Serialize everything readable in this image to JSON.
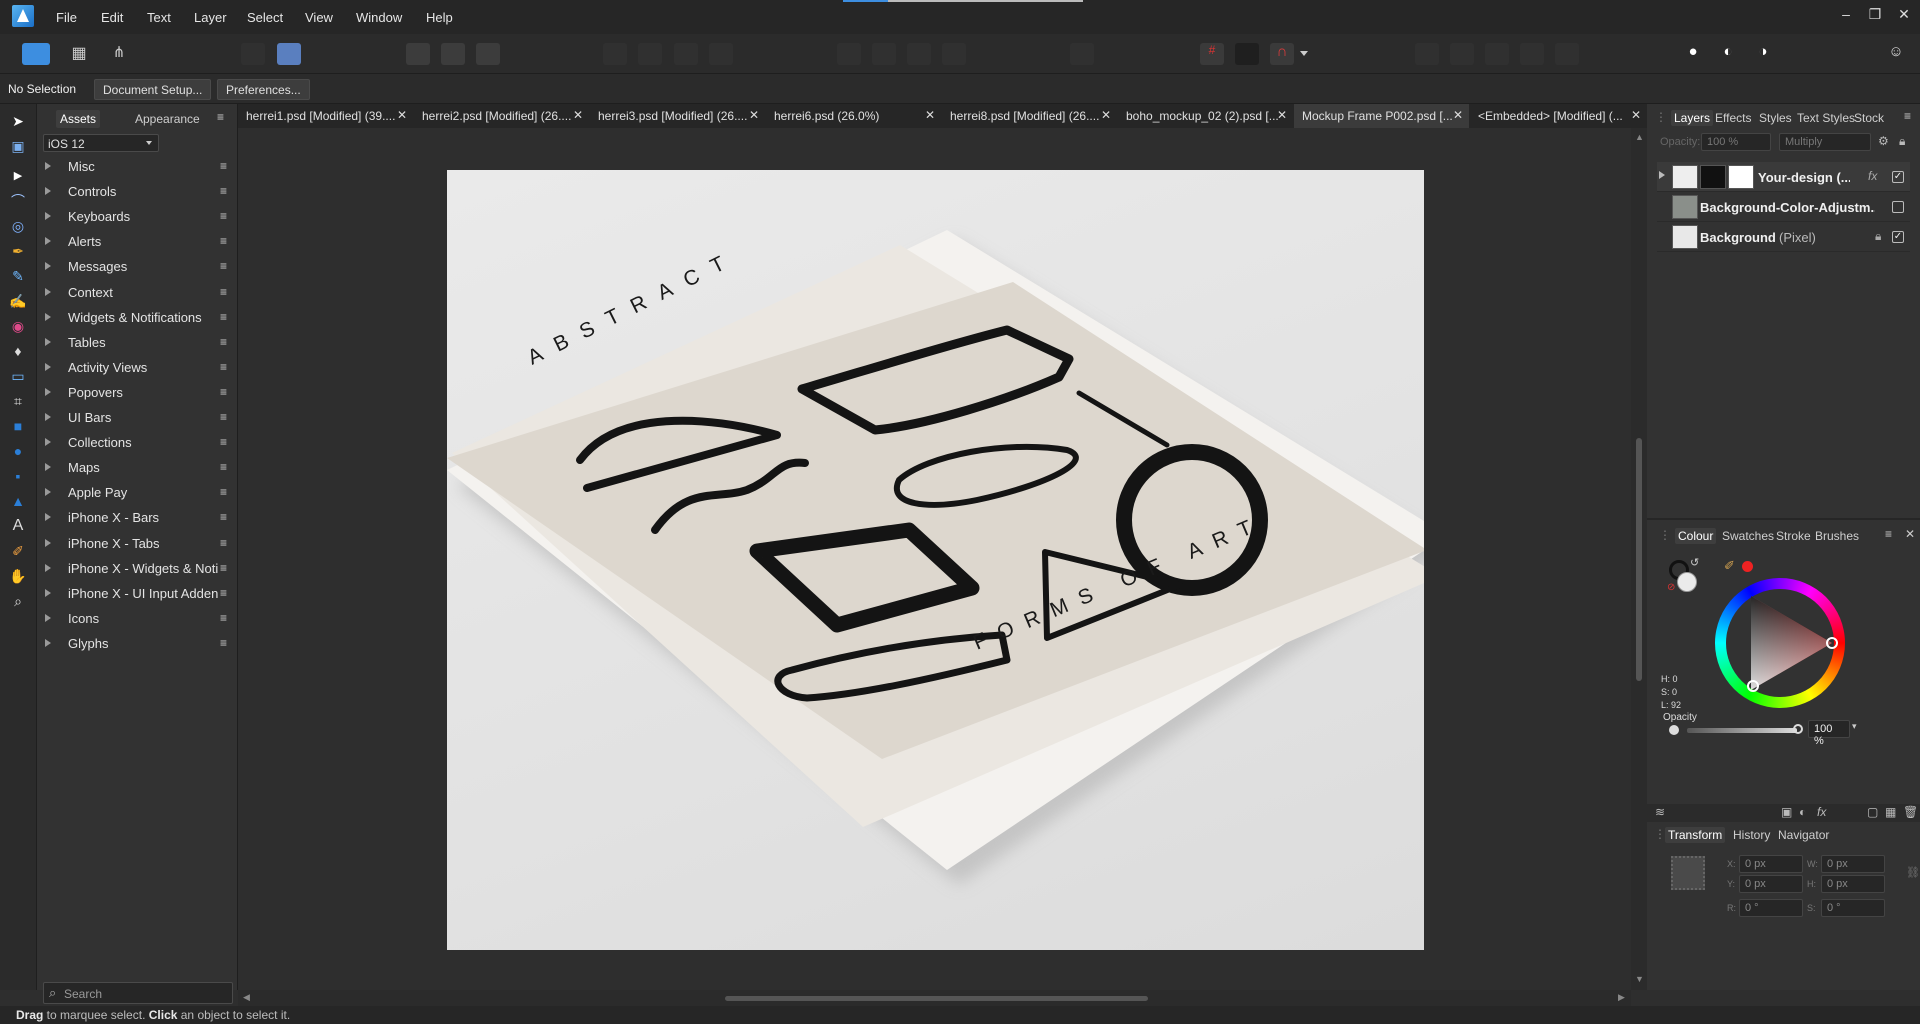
{
  "menu": [
    "File",
    "Edit",
    "Text",
    "Layer",
    "Select",
    "View",
    "Window",
    "Help"
  ],
  "window_controls": {
    "minimize": "–",
    "restore": "❐",
    "close": "✕"
  },
  "context": {
    "selection": "No Selection",
    "document_setup": "Document Setup...",
    "preferences": "Preferences..."
  },
  "left_panel": {
    "tabs": [
      "Assets",
      "Appearance"
    ],
    "dropdown": "iOS 12",
    "items": [
      "Misc",
      "Controls",
      "Keyboards",
      "Alerts",
      "Messages",
      "Context",
      "Widgets & Notifications",
      "Tables",
      "Activity Views",
      "Popovers",
      "UI Bars",
      "Collections",
      "Maps",
      "Apple Pay",
      "iPhone X - Bars",
      "iPhone X - Tabs",
      "iPhone X - Widgets & Noti",
      "iPhone X - UI Input Addend",
      "Icons",
      "Glyphs"
    ],
    "search_placeholder": "Search"
  },
  "doc_tabs": [
    "herrei1.psd [Modified] (39....",
    "herrei2.psd [Modified] (26....",
    "herrei3.psd [Modified] (26....",
    "herrei6.psd (26.0%)",
    "herrei8.psd [Modified] (26....",
    "boho_mockup_02 (2).psd [...",
    "Mockup Frame P002.psd [...",
    "<Embedded> [Modified] (..."
  ],
  "artwork": {
    "top_text": "ABSTRACT",
    "bottom_text": "FORMS OF ART"
  },
  "right_panel": {
    "layer_tabs": [
      "Layers",
      "Effects",
      "Styles",
      "Text Styles",
      "Stock"
    ],
    "opacity_label": "Opacity:",
    "opacity_value": "100 %",
    "blend_mode": "Multiply",
    "layers": [
      {
        "name": "Your-design (...",
        "checked": true
      },
      {
        "name": "Background-Color-Adjustm...",
        "checked": false
      },
      {
        "name": "Background",
        "suffix": "(Pixel)",
        "checked": true
      }
    ],
    "colour_tabs": [
      "Colour",
      "Swatches",
      "Stroke",
      "Brushes"
    ],
    "hsl": {
      "h": "H: 0",
      "s": "S: 0",
      "l": "L: 92"
    },
    "colour_opacity_label": "Opacity",
    "colour_opacity_value": "100 %",
    "transform_tabs": [
      "Transform",
      "History",
      "Navigator"
    ],
    "transform": {
      "x": "0 px",
      "y": "0 px",
      "w": "0 px",
      "h": "0 px",
      "r": "0 °",
      "s": "0 °"
    },
    "transform_labels": {
      "x": "X:",
      "y": "Y:",
      "w": "W:",
      "h": "H:",
      "r": "R:",
      "s": "S:"
    }
  },
  "status": {
    "drag": "Drag",
    "drag_text": " to marquee select. ",
    "click": "Click",
    "click_text": " an object to select it."
  },
  "colors": {
    "accent": "#3d8ee0",
    "panel": "#323232",
    "canvas": "#2e2e2e"
  }
}
